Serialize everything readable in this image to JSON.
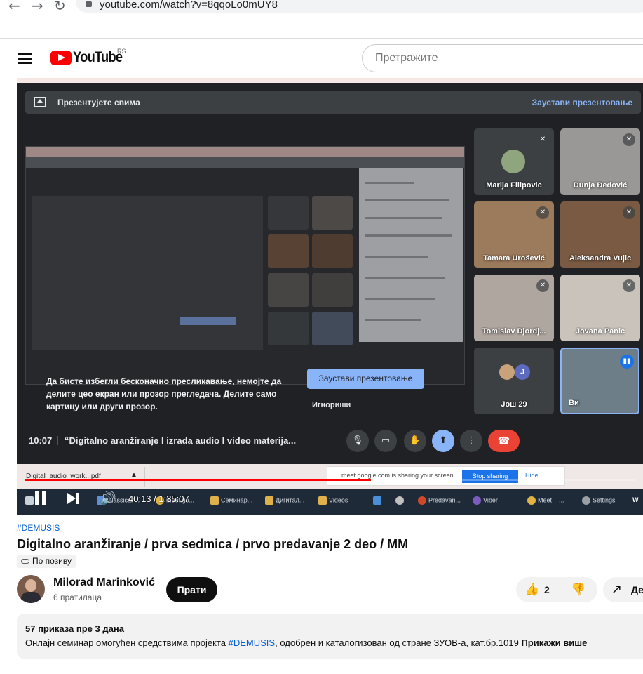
{
  "browser": {
    "url": "youtube.com/watch?v=8qqoLo0mUY8"
  },
  "header": {
    "logo_text": "YouTube",
    "country_code": "RS",
    "search_placeholder": "Претражите"
  },
  "meet": {
    "presenting_label": "Презентујете свима",
    "stop_presenting": "Заустави презентовање",
    "warning_text": "Да бисте избегли бесконачно пресликавање, немојте да делите цео екран или прозор прегледача. Делите само картицу или други прозор.",
    "warning_stop_button": "Заустави презентовање",
    "ignore_label": "Игнориши",
    "participants": [
      {
        "name": "Marija Filipovic",
        "bg": "#3c4043"
      },
      {
        "name": "Dunja Đedović",
        "bg": "#9a9896"
      },
      {
        "name": "Tamara Urošević",
        "bg": "#9c7a5c"
      },
      {
        "name": "Aleksandra Vujic",
        "bg": "#7a5a42"
      },
      {
        "name": "Tomislav Djordj...",
        "bg": "#b0a6a0"
      },
      {
        "name": "Jovana Panic",
        "bg": "#c9c3bc"
      }
    ],
    "more_count": "Још 29",
    "more_initial": "J",
    "self_label": "Ви",
    "time": "10:07",
    "meeting_title": "“Digitalno aranžiranje I izrada audio I video materija...",
    "download_file": "Digital_audio_work...pdf",
    "share_notice": "meet.google.com is sharing your screen.",
    "share_stop": "Stop sharing",
    "share_hide": "Hide"
  },
  "taskbar": {
    "items": [
      {
        "label": "Classical ...",
        "color": "#5f8fd6"
      },
      {
        "label": "meet.go...",
        "color": "#e3b341"
      },
      {
        "label": "Семинар...",
        "color": "#e0b04a"
      },
      {
        "label": "Дигитал...",
        "color": "#e0b04a"
      },
      {
        "label": "Videos",
        "color": "#e0b04a"
      },
      {
        "label": "",
        "color": "#4a90d9"
      },
      {
        "label": "",
        "color": "#c0c0c0"
      },
      {
        "label": "Predavan...",
        "color": "#d24726"
      },
      {
        "label": "Viber",
        "color": "#7d5bbe"
      },
      {
        "label": "Meet – ...",
        "color": "#e3b341"
      },
      {
        "label": "Settings",
        "color": "#9aa0a6"
      },
      {
        "label": "W",
        "color": "#2b579a"
      }
    ]
  },
  "player": {
    "time_display": "40:13 / 1:35:07",
    "progress_fraction": 0.567
  },
  "video": {
    "hashtag": "#DEMUSIS",
    "title": "Digitalno aranžiranje / prva sedmica / prvo predavanje 2 deo / MM",
    "visibility": "По позиву",
    "channel_name": "Milorad Marinković",
    "subscribers": "6 пратилаца",
    "subscribe_label": "Прати",
    "likes": "2",
    "share_label": "Де",
    "views_date": "57 приказа  пре 3 дана",
    "description_pre": "Онлајн семинар омогућен средствима пројекта ",
    "description_hashtag": "#DEMUSIS",
    "description_post": ", одобрен и каталогизован од стране ЗУОВ-а, кат.бр.1019 ",
    "show_more": "Прикажи више"
  },
  "colors": {
    "yt_red": "#ff0000",
    "link_blue": "#065fd4",
    "meet_blue": "#8ab4f8",
    "end_call_red": "#ea4335"
  }
}
